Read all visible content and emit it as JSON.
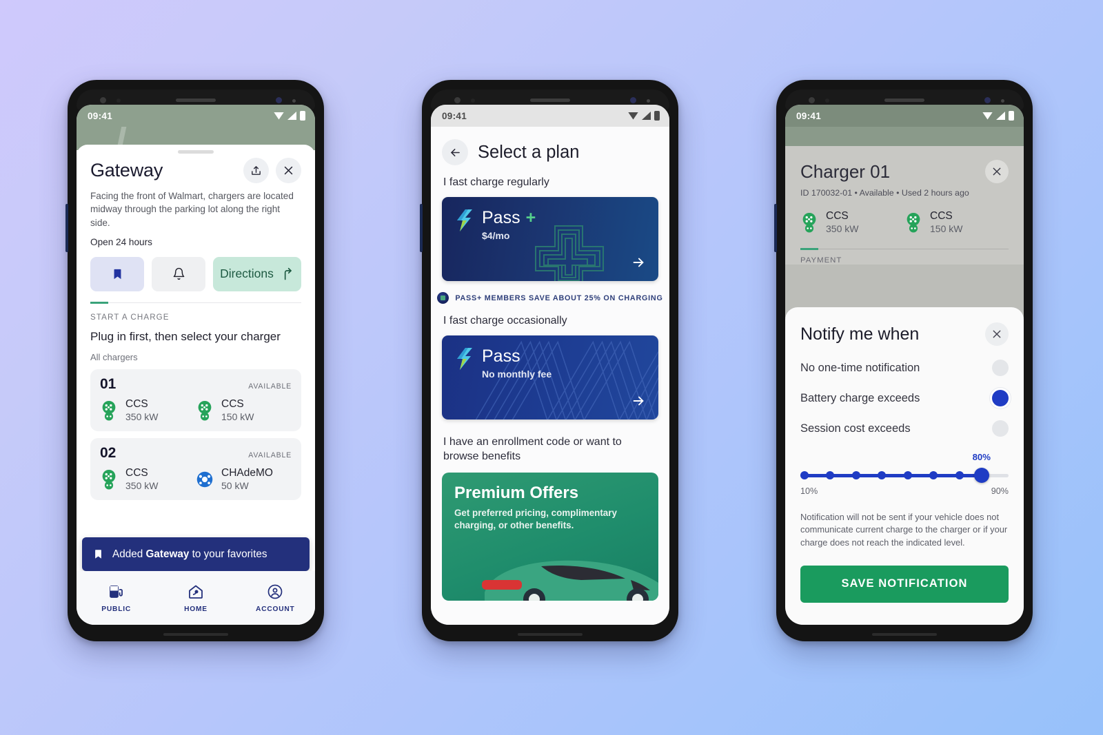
{
  "background": {
    "from": "#cfc9fc",
    "to": "#97c1fa"
  },
  "phone1": {
    "status": {
      "time": "09:41"
    },
    "sheet": {
      "title": "Gateway",
      "share_icon": "share-icon",
      "close_icon": "close-icon",
      "description": "Facing the front of Walmart, chargers are located midway through the parking lot along the right side.",
      "hours": "Open 24 hours",
      "favorite_icon": "bookmark-icon",
      "notify_icon": "bell-icon",
      "directions_label": "Directions",
      "directions_icon": "directions-arrow-icon"
    },
    "start_charge": {
      "eyebrow": "START A CHARGE",
      "instruction": "Plug in first, then select your charger",
      "list_label": "All chargers"
    },
    "chargers": [
      {
        "number": "01",
        "status": "AVAILABLE",
        "connectors": [
          {
            "type": "CCS",
            "power": "350 kW",
            "icon": "ccs-connector-icon",
            "color": "#26a35a"
          },
          {
            "type": "CCS",
            "power": "150 kW",
            "icon": "ccs-connector-icon",
            "color": "#26a35a"
          }
        ]
      },
      {
        "number": "02",
        "status": "AVAILABLE",
        "connectors": [
          {
            "type": "CCS",
            "power": "350 kW",
            "icon": "ccs-connector-icon",
            "color": "#26a35a"
          },
          {
            "type": "CHAdeMO",
            "power": "50 kW",
            "icon": "chademo-connector-icon",
            "color": "#1f6fd0"
          }
        ]
      }
    ],
    "snackbar": {
      "icon": "bookmark-icon",
      "prefix": "Added ",
      "highlight": "Gateway",
      "suffix": " to your favorites",
      "color": "#23307c"
    },
    "nav": [
      {
        "label": "PUBLIC",
        "icon": "charging-station-icon"
      },
      {
        "label": "HOME",
        "icon": "home-charger-icon"
      },
      {
        "label": "ACCOUNT",
        "icon": "account-icon"
      }
    ]
  },
  "phone2": {
    "status": {
      "time": "09:41"
    },
    "header": {
      "back_icon": "back-arrow-icon",
      "title": "Select a plan"
    },
    "sections": [
      {
        "label": "I fast charge regularly"
      },
      {
        "label": "I fast charge occasionally"
      },
      {
        "label": "I have an enrollment code or want to browse benefits"
      }
    ],
    "plans": [
      {
        "name": "Pass",
        "plus": "+",
        "price": "$4/mo",
        "arrow_icon": "right-arrow-icon",
        "logo": "bolt-logo-icon"
      },
      {
        "name": "Pass",
        "plus": "",
        "price": "No monthly fee",
        "arrow_icon": "right-arrow-icon",
        "logo": "bolt-logo-icon"
      }
    ],
    "promo": {
      "icon": "savings-badge-icon",
      "text": "PASS+ MEMBERS SAVE ABOUT 25% ON CHARGING"
    },
    "offer": {
      "title": "Premium Offers",
      "subtitle": "Get preferred pricing, complimentary charging, or other benefits.",
      "image": "green-car-illustration"
    }
  },
  "phone3": {
    "status": {
      "time": "09:41"
    },
    "charger": {
      "title": "Charger 01",
      "close_icon": "close-icon",
      "meta": "ID 170032-01  •  Available  •  Used 2 hours ago",
      "connectors": [
        {
          "type": "CCS",
          "power": "350 kW",
          "icon": "ccs-connector-icon"
        },
        {
          "type": "CCS",
          "power": "150 kW",
          "icon": "ccs-connector-icon"
        }
      ],
      "payment_label": "PAYMENT"
    },
    "modal": {
      "title": "Notify me when",
      "close_icon": "close-icon",
      "options": [
        {
          "label": "No one-time notification",
          "selected": false
        },
        {
          "label": "Battery charge exceeds",
          "selected": true
        },
        {
          "label": "Session cost exceeds",
          "selected": false
        }
      ],
      "slider": {
        "value_label": "80%",
        "min_label": "10%",
        "max_label": "90%",
        "value": 80,
        "min": 10,
        "max": 90,
        "accent": "#1f3cc4"
      },
      "note": "Notification will not be sent if your vehicle does not communicate current charge to the charger or if your charge does not reach the indicated level.",
      "save_label": "SAVE NOTIFICATION",
      "save_color": "#1a9b5e"
    }
  }
}
